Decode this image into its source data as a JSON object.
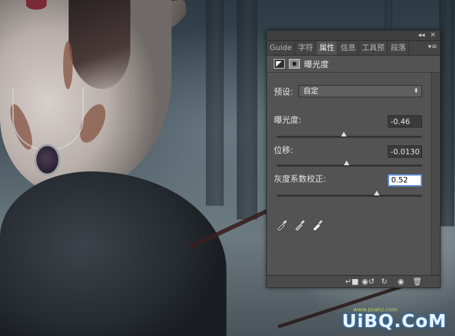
{
  "panel": {
    "tabs": [
      "Guide",
      "字符",
      "属性",
      "信息",
      "工具预",
      "段落"
    ],
    "active_tab_index": 2,
    "header_title": "曝光度",
    "preset_label": "预设:",
    "preset_value": "自定",
    "exposure_label": "曝光度:",
    "exposure_value": "-0.46",
    "exposure_level": 0.46,
    "offset_label": "位移:",
    "offset_value": "-0.0130",
    "offset_level": 0.48,
    "gamma_label": "灰度系数校正:",
    "gamma_value": "0.52",
    "gamma_level": 0.69
  },
  "watermark": {
    "text": "UiBQ.CoM",
    "small": "www.psahz.com"
  },
  "colors": {
    "panel_bg": "#535353",
    "active_tab": "#535353",
    "focus_border": "#5b8bd6"
  },
  "icons": [
    "collapse-icon",
    "close-icon",
    "panel-menu-icon",
    "exposure-adjustment-icon",
    "mask-icon",
    "black-point-eyedropper-icon",
    "gray-point-eyedropper-icon",
    "white-point-eyedropper-icon",
    "clip-to-layer-icon",
    "view-previous-icon",
    "reset-icon",
    "visibility-eye-icon",
    "trash-icon"
  ]
}
